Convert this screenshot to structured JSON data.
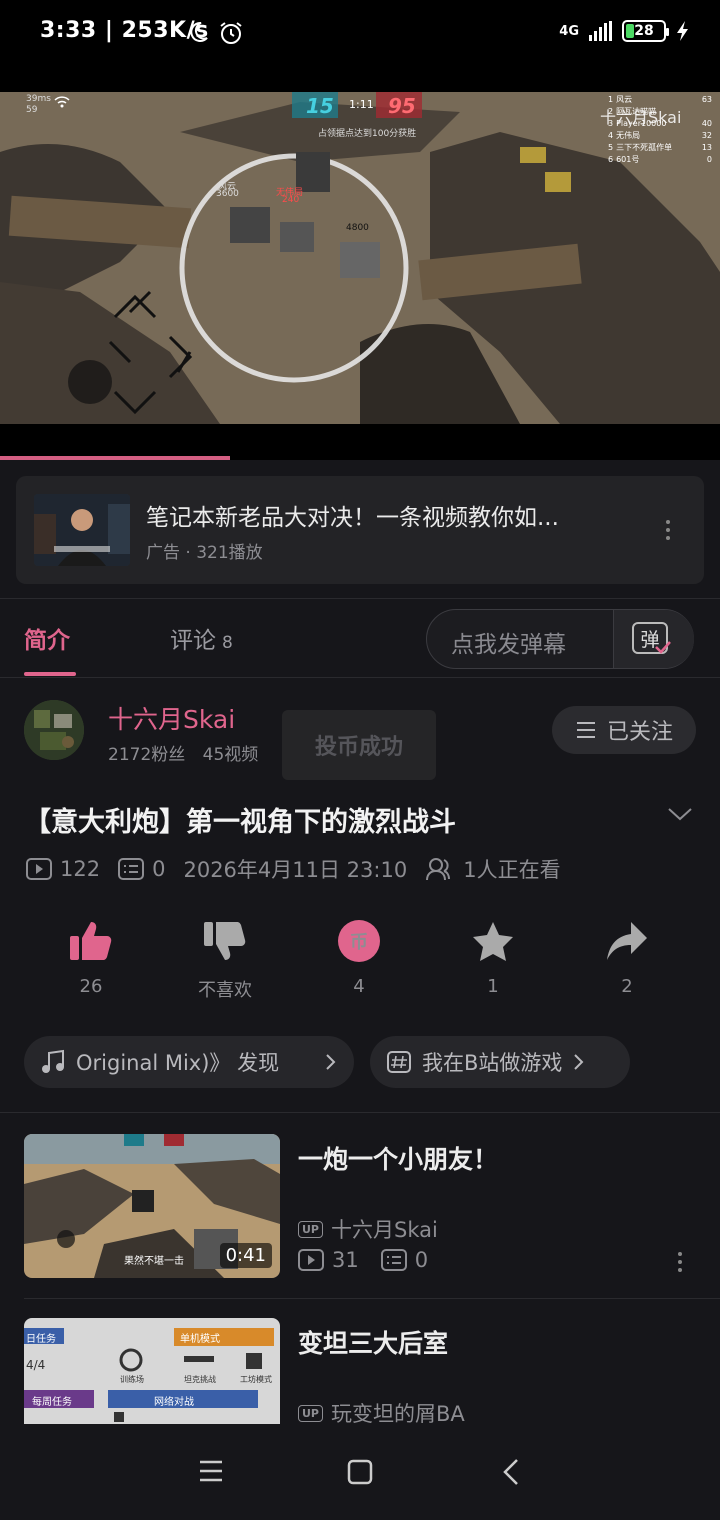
{
  "status_bar": {
    "time": "3:33",
    "speed": "253K/s",
    "network": "4G",
    "battery": "28"
  },
  "video": {
    "score_blue": "15",
    "timer": "1:11",
    "score_red": "95",
    "objective": "占领据点达到100分获胜",
    "ping": "39ms",
    "fps": "59",
    "hp_value": "4800",
    "player_label_1": "风云",
    "player_label_1_hp": "3600",
    "player_label_2": "无伟局",
    "player_label_2_hp": "240",
    "watermark": "十六月Skai",
    "scoreboard": [
      {
        "rank": "1",
        "name": "风云",
        "score": "63"
      },
      {
        "rank": "2",
        "name": "阿瓦达喵喵",
        "score": ""
      },
      {
        "rank": "3",
        "name": "Player10000",
        "score": "40"
      },
      {
        "rank": "4",
        "name": "无伟局",
        "score": "32"
      },
      {
        "rank": "5",
        "name": "三下不死孤作单",
        "score": "13"
      },
      {
        "rank": "6",
        "name": "601号",
        "score": "0"
      }
    ],
    "progress_fraction": 0.32
  },
  "ad": {
    "title": "笔记本新老品大对决！一条视频教你如...",
    "meta": "广告 · 321播放"
  },
  "tabs": {
    "intro": "简介",
    "comments": "评论",
    "comments_count": "8",
    "danmu_placeholder": "点我发弹幕",
    "danmu_button": "弹"
  },
  "uploader": {
    "name": "十六月Skai",
    "fans": "2172粉丝",
    "videos": "45视频",
    "follow": "已关注"
  },
  "toast": "投币成功",
  "video_info": {
    "title": "【意大利炮】第一视角下的激烈战斗",
    "plays": "122",
    "danmaku": "0",
    "date": "2026年4月11日 23:10",
    "watching": "1人正在看"
  },
  "actions": {
    "like": "26",
    "dislike": "不喜欢",
    "coin": "4",
    "coin_icon": "币",
    "favorite": "1",
    "share": "2"
  },
  "tags": {
    "music": "Original Mix)》  发现",
    "game": "我在B站做游戏"
  },
  "related": [
    {
      "title": "一炮一个小朋友！",
      "up_badge": "UP",
      "uploader": "十六月Skai",
      "plays": "31",
      "danmaku": "0",
      "duration": "0:41",
      "subtitle": "果然不堪一击"
    },
    {
      "title": "变坦三大后室",
      "up_badge": "UP",
      "uploader": "玩变坦的屑BA",
      "thumb_labels": [
        "日任务",
        "4/4",
        "单机模式",
        "每周任务",
        "网络对战",
        "训练场",
        "坦克挑战",
        "工坊模式"
      ]
    }
  ],
  "colors": {
    "accent": "#e0658d",
    "background": "#16161a",
    "card": "#232326"
  }
}
